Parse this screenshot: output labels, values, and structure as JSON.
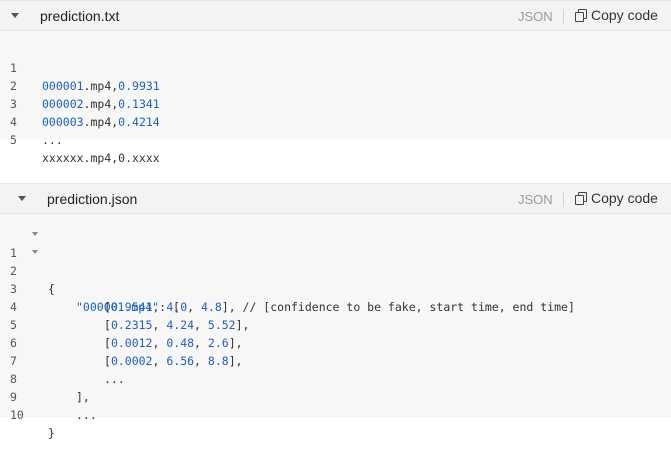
{
  "block1": {
    "filename": "prediction.txt",
    "lang": "JSON",
    "copy_label": "Copy code",
    "lines": [
      {
        "n": "1",
        "a": "000001",
        "b": ".mp4,",
        "c": "0.9931"
      },
      {
        "n": "2",
        "a": "000002",
        "b": ".mp4,",
        "c": "0.1341"
      },
      {
        "n": "3",
        "a": "000003",
        "b": ".mp4,",
        "c": "0.4214"
      },
      {
        "n": "4",
        "t": "..."
      },
      {
        "n": "5",
        "t": "xxxxxx.mp4,0.xxxx"
      }
    ]
  },
  "block2": {
    "filename": "prediction.json",
    "lang": "JSON",
    "copy_label": "Copy code",
    "lines": [
      {
        "n": "1",
        "t": "{"
      },
      {
        "n": "2",
        "key": "\"000001.mp4\"",
        "rest": ": ["
      },
      {
        "n": "3",
        "v1": "0.9541",
        "v2": "4.0",
        "v3": "4.8",
        "tail": "], // [confidence to be fake, start time, end time]"
      },
      {
        "n": "4",
        "v1": "0.2315",
        "v2": "4.24",
        "v3": "5.52",
        "tail": "],"
      },
      {
        "n": "5",
        "v1": "0.0012",
        "v2": "0.48",
        "v3": "2.6",
        "tail": "],"
      },
      {
        "n": "6",
        "v1": "0.0002",
        "v2": "6.56",
        "v3": "8.8",
        "tail": "],"
      },
      {
        "n": "7",
        "t": "..."
      },
      {
        "n": "8",
        "t": "],"
      },
      {
        "n": "9",
        "t": "..."
      },
      {
        "n": "10",
        "t": "}"
      }
    ]
  }
}
